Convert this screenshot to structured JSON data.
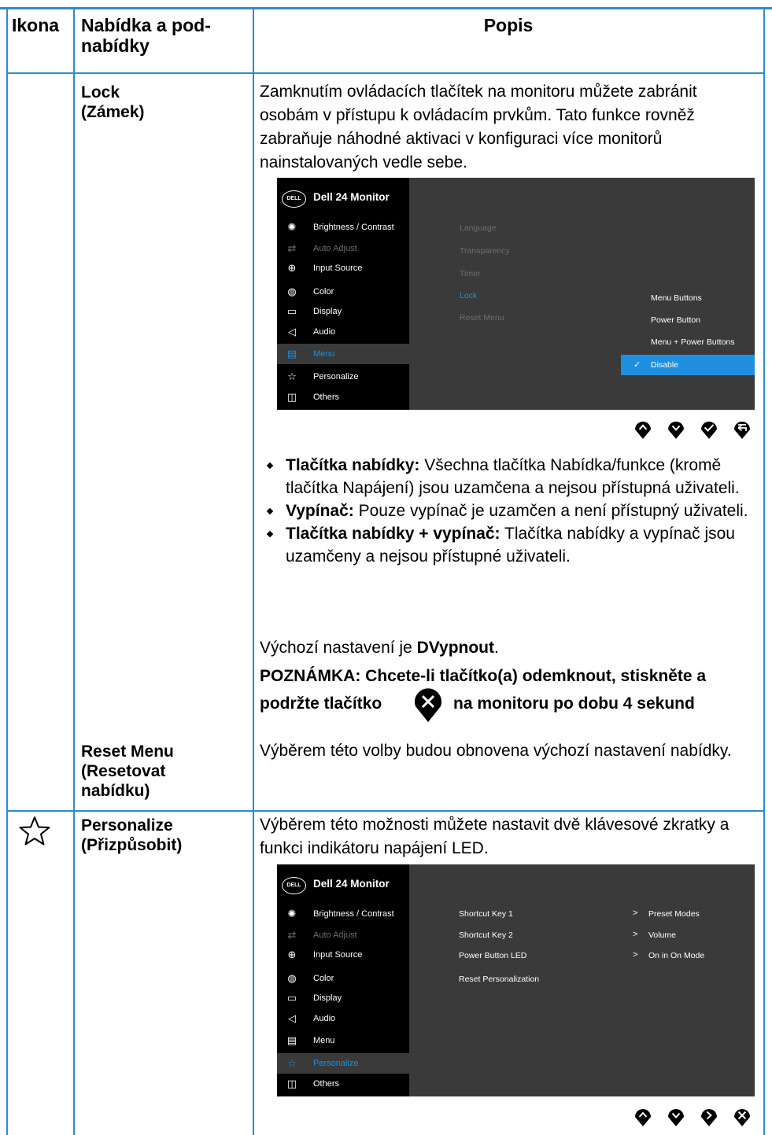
{
  "header": {
    "col1": "Ikona",
    "col2": "Nabídka a pod-nabídky",
    "col3": "Popis"
  },
  "lock": {
    "name_line1": "Lock",
    "name_line2": "(Zámek)",
    "description": "Zamknutím ovládacích tlačítek na monitoru můžete zabránit osobám v přístupu k ovládacím prvkům. Tato funkce rovněž zabraňuje náhodné aktivaci v konfiguraci více monitorů nainstalovaných vedle sebe.",
    "osd": {
      "logo": "DELL",
      "title": "Dell 24 Monitor",
      "menu": [
        "Brightness / Contrast",
        "Auto Adjust",
        "Input Source",
        "Color",
        "Display",
        "Audio",
        "Menu",
        "Personalize",
        "Others"
      ],
      "submenu": [
        "Language",
        "Transparency",
        "Timer",
        "Lock",
        "Reset Menu"
      ],
      "options": [
        "Menu Buttons",
        "Power Button",
        "Menu + Power Buttons",
        "Disable"
      ]
    },
    "bullets": [
      {
        "term": "Tlačítka nabídky:",
        "text": " Všechna tlačítka Nabídka/funkce (kromě tlačítka Napájení) jsou uzamčena a nejsou přístupná uživateli."
      },
      {
        "term": "Vypínač:",
        "text": " Pouze vypínač je uzamčen a není přístupný uživateli."
      },
      {
        "term": "Tlačítka nabídky + vypínač:",
        "text": " Tlačítka nabídky a vypínač jsou uzamčeny a nejsou přístupné uživateli."
      }
    ],
    "default_prefix": "Výchozí nastavení je ",
    "default_value": "DVypnout",
    "default_suffix": ".",
    "note_line1": "POZNÁMKA: Chcete-li tlačítko(a) odemknout, stiskněte a",
    "note_line2_a": "podržte tlačítko",
    "note_line2_b": "na monitoru po dobu 4 sekund"
  },
  "reset_menu": {
    "name_line1": "Reset Menu",
    "name_line2": "(Resetovat",
    "name_line3": "nabídku)",
    "description": "Výběrem této volby budou obnovena výchozí nastavení nabídky."
  },
  "personalize": {
    "icon": "star-outline-icon",
    "name_line1": "Personalize",
    "name_line2": "(Přizpůsobit)",
    "description": "Výběrem této možnosti můžete nastavit dvě klávesové zkratky a funkci indikátoru napájení LED.",
    "osd": {
      "logo": "DELL",
      "title": "Dell 24 Monitor",
      "menu": [
        "Brightness / Contrast",
        "Auto Adjust",
        "Input Source",
        "Color",
        "Display",
        "Audio",
        "Menu",
        "Personalize",
        "Others"
      ],
      "settings": [
        "Shortcut Key 1",
        "Shortcut Key 2",
        "Power Button LED",
        "Reset Personalization"
      ],
      "values": [
        "Preset Modes",
        "Volume",
        "On in On Mode"
      ]
    }
  },
  "colors": {
    "rule": "#2d8bd0",
    "osd_accent": "#1f8fe0",
    "osd_panel": "#3a3a3a"
  }
}
